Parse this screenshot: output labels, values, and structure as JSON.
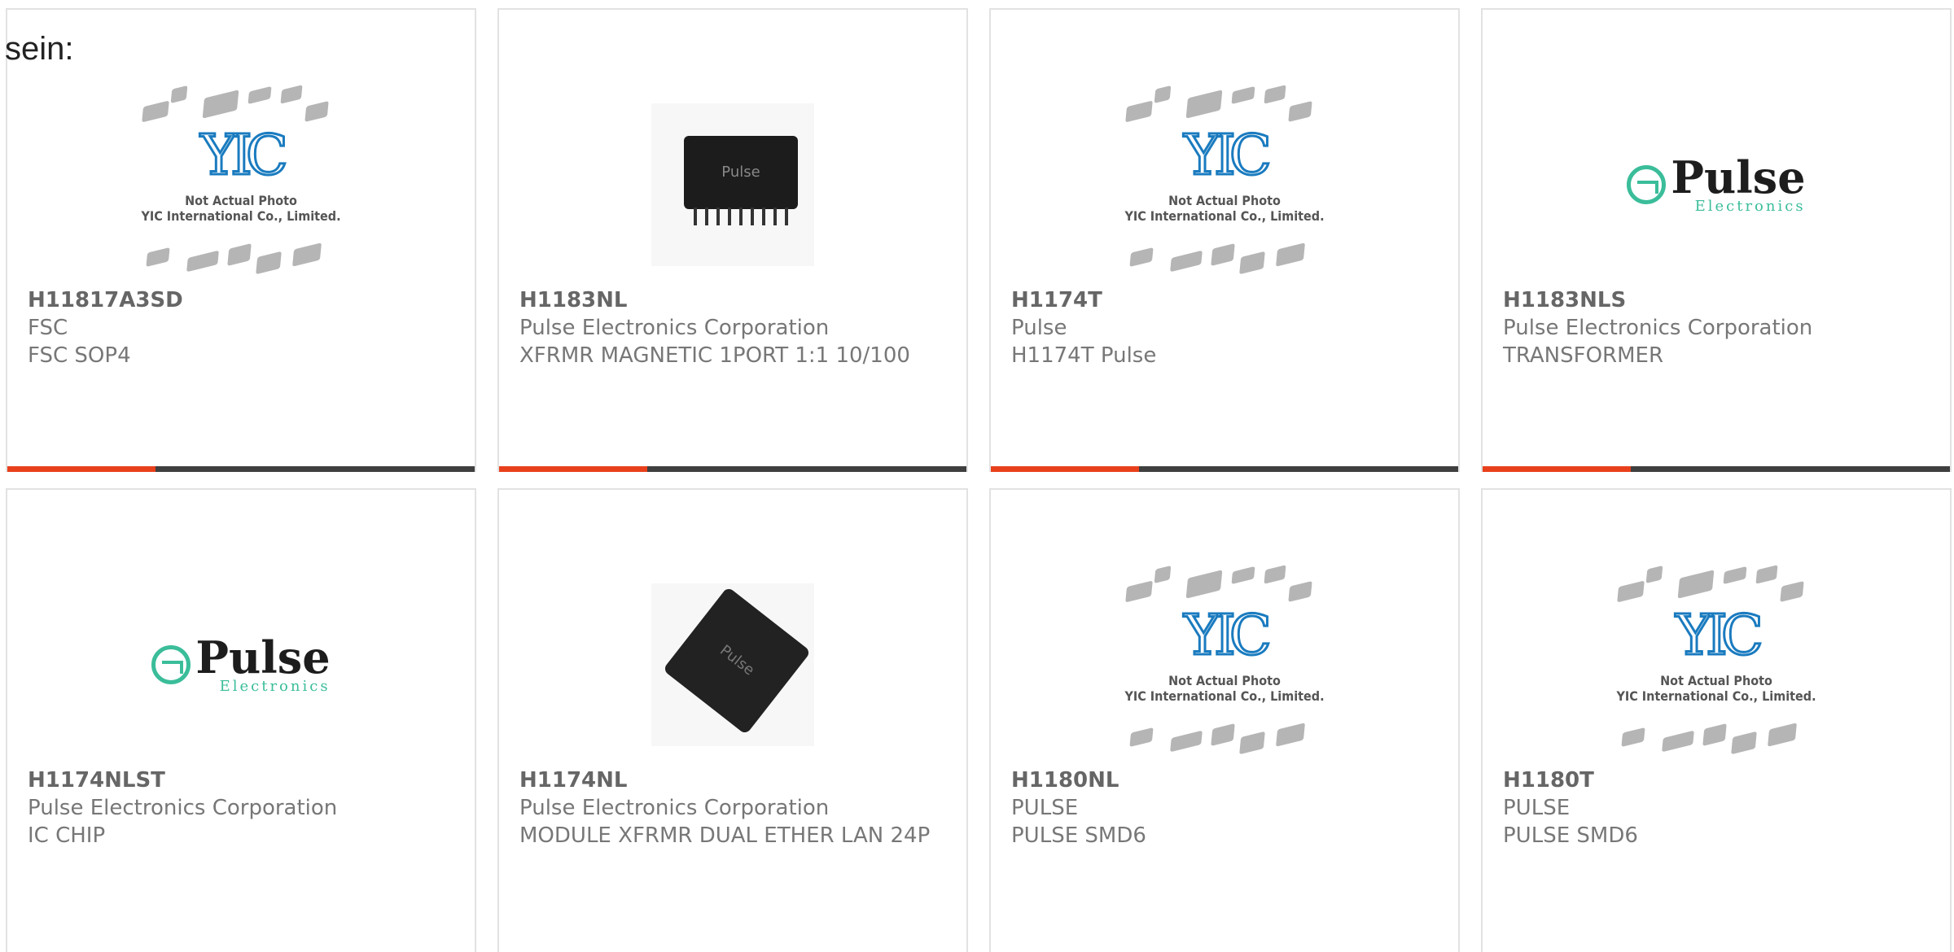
{
  "header": {
    "fragment": "sein:"
  },
  "placeholder": {
    "caption_line1": "Not Actual Photo",
    "caption_line2": "YIC International Co., Limited.",
    "logo": "YIC"
  },
  "pulse_logo": {
    "word": "Pulse",
    "sub": "Electronics",
    "chip_mark": "Pulse"
  },
  "colors": {
    "accent": "#e8401c",
    "bar": "#3f3f3f",
    "pulse_green": "#3bbd9a",
    "yic_blue": "#1a7bbf"
  },
  "products": [
    {
      "part": "H11817A3SD",
      "manufacturer": "FSC",
      "description": "FSC SOP4",
      "image": "yic-placeholder"
    },
    {
      "part": "H1183NL",
      "manufacturer": "Pulse Electronics Corporation",
      "description": "XFRMR MAGNETIC 1PORT 1:1 10/100",
      "image": "smd-transformer-photo"
    },
    {
      "part": "H1174T",
      "manufacturer": "Pulse",
      "description": "H1174T Pulse",
      "image": "yic-placeholder"
    },
    {
      "part": "H1183NLS",
      "manufacturer": "Pulse Electronics Corporation",
      "description": "TRANSFORMER",
      "image": "pulse-logo"
    },
    {
      "part": "H1174NLST",
      "manufacturer": "Pulse Electronics Corporation",
      "description": "IC CHIP",
      "image": "pulse-logo"
    },
    {
      "part": "H1174NL",
      "manufacturer": "Pulse Electronics Corporation",
      "description": "MODULE XFRMR DUAL ETHER LAN 24P",
      "image": "qfp-module-photo"
    },
    {
      "part": "H1180NL",
      "manufacturer": "PULSE",
      "description": "PULSE SMD6",
      "image": "yic-placeholder"
    },
    {
      "part": "H1180T",
      "manufacturer": "PULSE",
      "description": "PULSE SMD6",
      "image": "yic-placeholder"
    }
  ]
}
